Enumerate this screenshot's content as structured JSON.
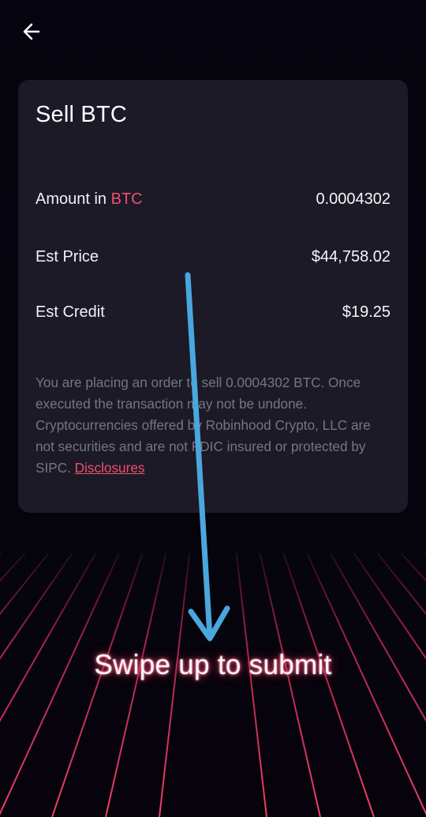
{
  "header": {
    "back_icon": "arrow-left-icon"
  },
  "card": {
    "title": "Sell BTC",
    "rows": [
      {
        "label_prefix": "Amount in ",
        "label_accent": "BTC",
        "value": "0.0004302"
      },
      {
        "label": "Est Price",
        "value": "$44,758.02"
      },
      {
        "label": "Est Credit",
        "value": "$19.25"
      }
    ],
    "disclaimer": "You are placing an order to sell 0.0004302 BTC. Once executed the transaction may not be undone. Cryptocurrencies offered by Robinhood Crypto, LLC are not securities and are not FDIC insured or protected by SIPC. ",
    "disclosures_link": "Disclosures"
  },
  "footer": {
    "swipe_label": "Swipe up to submit"
  },
  "colors": {
    "background": "#05040d",
    "card": "#1b1a26",
    "accent": "#f0506e",
    "grid": "#e0305e",
    "annotation_arrow": "#4aa7de"
  }
}
